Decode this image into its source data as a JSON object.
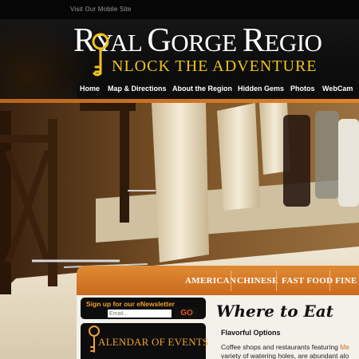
{
  "topbar": {
    "mobile_link": "Visit Our Mobile Site"
  },
  "logo": {
    "title_r": "R",
    "title_rest": "YAL ",
    "title_g": "G",
    "title_orge": "ORGE ",
    "title_region_r": "R",
    "title_region_rest": "EGIO",
    "tagline": "NLOCK THE ADVENTURE",
    "accent_color": "#f0c419"
  },
  "nav": {
    "items": [
      {
        "label": "Home"
      },
      {
        "label": "Map & Directions"
      },
      {
        "label": "About the Region"
      },
      {
        "label": "Hidden Gems"
      },
      {
        "label": "Photos"
      },
      {
        "label": "WebCam"
      }
    ]
  },
  "tabs": {
    "items": [
      {
        "label": "AMERICAN"
      },
      {
        "label": "CHINESE"
      },
      {
        "label": "FAST FOOD"
      },
      {
        "label": "FINE D"
      }
    ]
  },
  "newsletter": {
    "label": "Sign up for our eNewsletter",
    "email_placeholder": "Email...",
    "go_label": "GO"
  },
  "calendar": {
    "label": "ALENDAR OF EVENTS"
  },
  "content": {
    "heading": "Where to Eat",
    "subheading": "Flavorful Options",
    "line1_prefix": "Coffee shops and restaurants featuring ",
    "line1_highlight": "Me",
    "line2": "variety of watering holes, are abundant alo"
  },
  "colors": {
    "brand_orange": "#e08a34",
    "accent_gold": "#f0a030"
  }
}
